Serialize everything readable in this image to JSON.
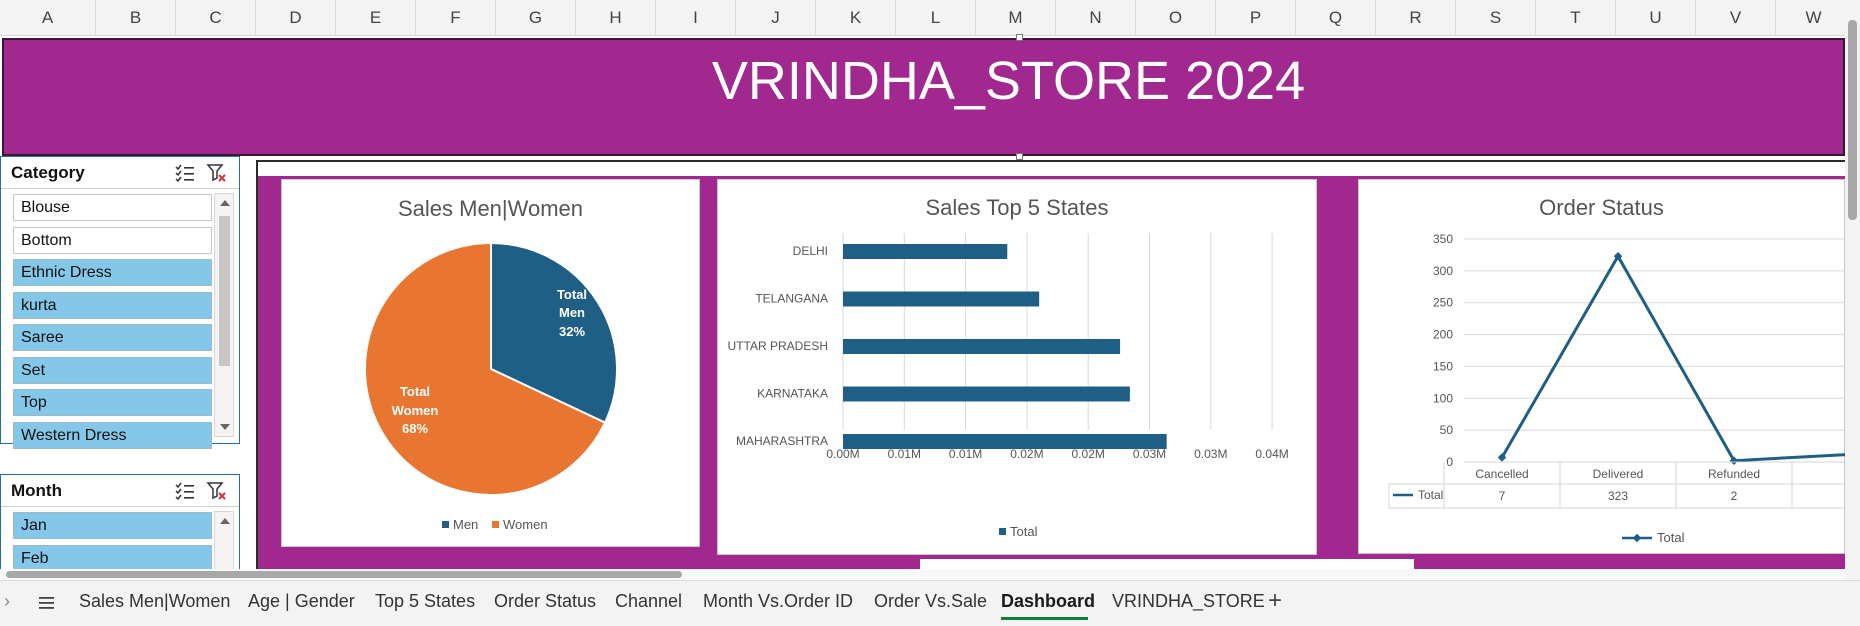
{
  "columns": [
    "A",
    "B",
    "C",
    "D",
    "E",
    "F",
    "G",
    "H",
    "I",
    "J",
    "K",
    "L",
    "M",
    "N",
    "O",
    "P",
    "Q",
    "R",
    "S",
    "T",
    "U",
    "V",
    "W"
  ],
  "banner": {
    "title": "VRINDHA_STORE 2024"
  },
  "slicers": {
    "category": {
      "title": "Category",
      "items": [
        {
          "label": "Blouse",
          "selected": false
        },
        {
          "label": "Bottom",
          "selected": false
        },
        {
          "label": "Ethnic Dress",
          "selected": true
        },
        {
          "label": "kurta",
          "selected": true
        },
        {
          "label": "Saree",
          "selected": true
        },
        {
          "label": "Set",
          "selected": true
        },
        {
          "label": "Top",
          "selected": true
        },
        {
          "label": "Western Dress",
          "selected": true
        }
      ]
    },
    "month": {
      "title": "Month",
      "items": [
        {
          "label": "Jan",
          "selected": true
        },
        {
          "label": "Feb",
          "selected": true
        }
      ]
    }
  },
  "charts": {
    "pie": {
      "title": "Sales Men|Women",
      "men_label_line1": "Total",
      "men_label_line2": "Men",
      "men_pct": "32%",
      "women_label_line1": "Total",
      "women_label_line2": "Women",
      "women_pct": "68%",
      "legend_men": "Men",
      "legend_women": "Women"
    },
    "bar": {
      "title": "Sales Top 5 States",
      "legend": "Total"
    },
    "line": {
      "title": "Order Status",
      "legend": "Total",
      "table_row_label": "Total"
    }
  },
  "chart_data": [
    {
      "type": "pie",
      "title": "Sales Men|Women",
      "categories": [
        "Men",
        "Women"
      ],
      "values": [
        32,
        68
      ],
      "colors": [
        "#1f5f85",
        "#e97630"
      ]
    },
    {
      "type": "bar",
      "title": "Sales Top 5 States",
      "categories": [
        "DELHI",
        "TELANGANA",
        "UTTAR PRADESH",
        "KARNATAKA",
        "MAHARASHTRA"
      ],
      "values": [
        0.0134,
        0.016,
        0.0226,
        0.0234,
        0.0264
      ],
      "series": [
        {
          "name": "Total",
          "values": [
            0.0134,
            0.016,
            0.0226,
            0.0234,
            0.0264
          ]
        }
      ],
      "xlim": [
        0,
        0.03
      ],
      "xticks": [
        "0.00M",
        "0.01M",
        "0.01M",
        "0.02M",
        "0.02M",
        "0.03M",
        "0.03M",
        "0.04M"
      ],
      "color": "#1f5f85",
      "grid": true
    },
    {
      "type": "line",
      "title": "Order Status",
      "categories": [
        "Cancelled",
        "Delivered",
        "Refunded",
        "Returned"
      ],
      "series": [
        {
          "name": "Total",
          "values": [
            7,
            323,
            2,
            12
          ]
        }
      ],
      "value_labels": [
        "7",
        "323",
        "2"
      ],
      "ylim": [
        0,
        350
      ],
      "yticks": [
        0,
        50,
        100,
        150,
        200,
        250,
        300,
        350
      ],
      "color": "#1f5f85",
      "grid": true
    }
  ],
  "tabs": [
    {
      "label": "Sales Men|Women",
      "active": false
    },
    {
      "label": "Age | Gender",
      "active": false
    },
    {
      "label": "Top 5 States",
      "active": false
    },
    {
      "label": "Order Status",
      "active": false
    },
    {
      "label": "Channel",
      "active": false
    },
    {
      "label": "Month Vs.Order ID",
      "active": false
    },
    {
      "label": "Order Vs.Sale",
      "active": false
    },
    {
      "label": "Dashboard",
      "active": true
    },
    {
      "label": "VRINDHA_STORE",
      "active": false
    }
  ],
  "colors": {
    "accent": "#a0288e",
    "men": "#1f5f85",
    "women": "#e97630",
    "slicer_selected": "#85c7e8",
    "active_tab": "#107c41"
  }
}
